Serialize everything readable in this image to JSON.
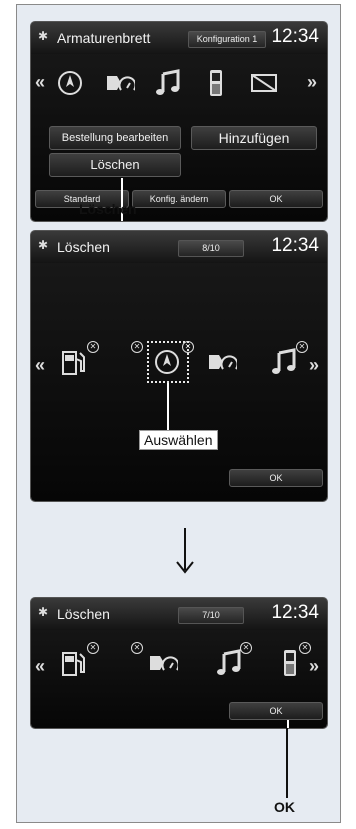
{
  "screen1": {
    "title": "Armaturenbrett",
    "config_pill": "Konfiguration 1",
    "time": "12:34",
    "buttons": {
      "edit_order": "Bestellung bearbeiten",
      "add": "Hinzufügen",
      "delete": "Löschen"
    },
    "bottom": [
      "Standard",
      "Konfig. ändern",
      "OK"
    ]
  },
  "caption1": "Löschen",
  "screen2": {
    "title": "Löschen",
    "counter": "8/10",
    "time": "12:34",
    "ok": "OK"
  },
  "caption2": "Auswählen",
  "screen3": {
    "title": "Löschen",
    "counter": "7/10",
    "time": "12:34",
    "ok": "OK"
  },
  "caption3": "OK",
  "icons": {
    "arrow_left": "«",
    "arrow_right": "»",
    "gear": "✱",
    "remove": "✕"
  }
}
